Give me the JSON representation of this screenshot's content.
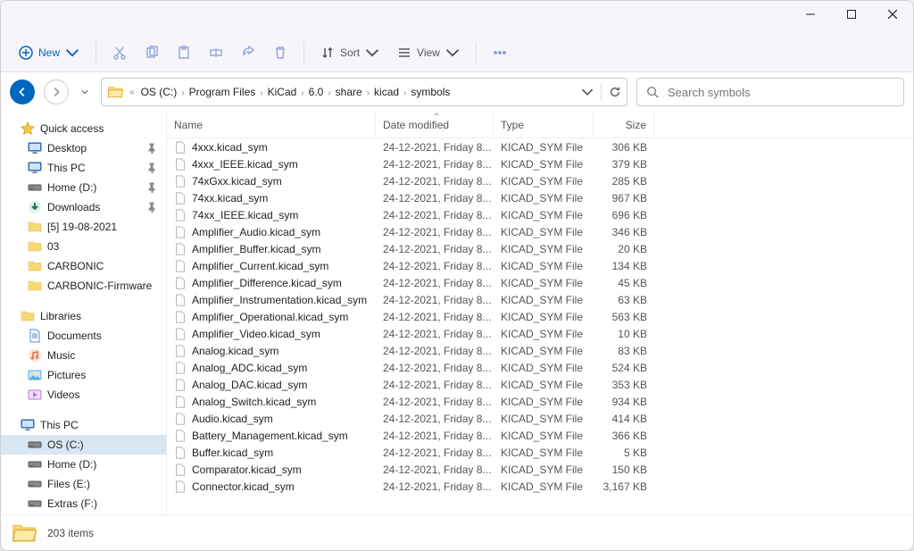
{
  "toolbar": {
    "new_label": "New",
    "sort_label": "Sort",
    "view_label": "View"
  },
  "breadcrumbs": [
    "OS (C:)",
    "Program Files",
    "KiCad",
    "6.0",
    "share",
    "kicad",
    "symbols"
  ],
  "search": {
    "placeholder": "Search symbols"
  },
  "sidebar": {
    "quick_access": "Quick access",
    "items1": [
      {
        "label": "Desktop",
        "icon": "monitor",
        "pin": true
      },
      {
        "label": "This PC",
        "icon": "monitor",
        "pin": true
      },
      {
        "label": "Home (D:)",
        "icon": "disk",
        "pin": true
      },
      {
        "label": "Downloads",
        "icon": "down",
        "pin": true
      },
      {
        "label": "[5] 19-08-2021",
        "icon": "folder",
        "pin": false
      },
      {
        "label": "03",
        "icon": "folder",
        "pin": false
      },
      {
        "label": "CARBONIC",
        "icon": "folder",
        "pin": false
      },
      {
        "label": "CARBONIC-Firmware",
        "icon": "folder",
        "pin": false
      }
    ],
    "libraries": "Libraries",
    "items2": [
      {
        "label": "Documents",
        "icon": "doc"
      },
      {
        "label": "Music",
        "icon": "mus"
      },
      {
        "label": "Pictures",
        "icon": "pic"
      },
      {
        "label": "Videos",
        "icon": "vid"
      }
    ],
    "this_pc": "This PC",
    "items3": [
      {
        "label": "OS (C:)",
        "icon": "disk",
        "selected": true
      },
      {
        "label": "Home (D:)",
        "icon": "disk"
      },
      {
        "label": "Files (E:)",
        "icon": "disk"
      },
      {
        "label": "Extras (F:)",
        "icon": "disk"
      }
    ]
  },
  "columns": {
    "name": "Name",
    "date": "Date modified",
    "type": "Type",
    "size": "Size"
  },
  "files": [
    {
      "name": "4xxx.kicad_sym",
      "date": "24-12-2021, Friday 8...",
      "type": "KICAD_SYM File",
      "size": "306 KB"
    },
    {
      "name": "4xxx_IEEE.kicad_sym",
      "date": "24-12-2021, Friday 8...",
      "type": "KICAD_SYM File",
      "size": "379 KB"
    },
    {
      "name": "74xGxx.kicad_sym",
      "date": "24-12-2021, Friday 8...",
      "type": "KICAD_SYM File",
      "size": "285 KB"
    },
    {
      "name": "74xx.kicad_sym",
      "date": "24-12-2021, Friday 8...",
      "type": "KICAD_SYM File",
      "size": "967 KB"
    },
    {
      "name": "74xx_IEEE.kicad_sym",
      "date": "24-12-2021, Friday 8...",
      "type": "KICAD_SYM File",
      "size": "696 KB"
    },
    {
      "name": "Amplifier_Audio.kicad_sym",
      "date": "24-12-2021, Friday 8...",
      "type": "KICAD_SYM File",
      "size": "346 KB"
    },
    {
      "name": "Amplifier_Buffer.kicad_sym",
      "date": "24-12-2021, Friday 8...",
      "type": "KICAD_SYM File",
      "size": "20 KB"
    },
    {
      "name": "Amplifier_Current.kicad_sym",
      "date": "24-12-2021, Friday 8...",
      "type": "KICAD_SYM File",
      "size": "134 KB"
    },
    {
      "name": "Amplifier_Difference.kicad_sym",
      "date": "24-12-2021, Friday 8...",
      "type": "KICAD_SYM File",
      "size": "45 KB"
    },
    {
      "name": "Amplifier_Instrumentation.kicad_sym",
      "date": "24-12-2021, Friday 8...",
      "type": "KICAD_SYM File",
      "size": "63 KB"
    },
    {
      "name": "Amplifier_Operational.kicad_sym",
      "date": "24-12-2021, Friday 8...",
      "type": "KICAD_SYM File",
      "size": "563 KB"
    },
    {
      "name": "Amplifier_Video.kicad_sym",
      "date": "24-12-2021, Friday 8...",
      "type": "KICAD_SYM File",
      "size": "10 KB"
    },
    {
      "name": "Analog.kicad_sym",
      "date": "24-12-2021, Friday 8...",
      "type": "KICAD_SYM File",
      "size": "83 KB"
    },
    {
      "name": "Analog_ADC.kicad_sym",
      "date": "24-12-2021, Friday 8...",
      "type": "KICAD_SYM File",
      "size": "524 KB"
    },
    {
      "name": "Analog_DAC.kicad_sym",
      "date": "24-12-2021, Friday 8...",
      "type": "KICAD_SYM File",
      "size": "353 KB"
    },
    {
      "name": "Analog_Switch.kicad_sym",
      "date": "24-12-2021, Friday 8...",
      "type": "KICAD_SYM File",
      "size": "934 KB"
    },
    {
      "name": "Audio.kicad_sym",
      "date": "24-12-2021, Friday 8...",
      "type": "KICAD_SYM File",
      "size": "414 KB"
    },
    {
      "name": "Battery_Management.kicad_sym",
      "date": "24-12-2021, Friday 8...",
      "type": "KICAD_SYM File",
      "size": "366 KB"
    },
    {
      "name": "Buffer.kicad_sym",
      "date": "24-12-2021, Friday 8...",
      "type": "KICAD_SYM File",
      "size": "5 KB"
    },
    {
      "name": "Comparator.kicad_sym",
      "date": "24-12-2021, Friday 8...",
      "type": "KICAD_SYM File",
      "size": "150 KB"
    },
    {
      "name": "Connector.kicad_sym",
      "date": "24-12-2021, Friday 8...",
      "type": "KICAD_SYM File",
      "size": "3,167 KB"
    }
  ],
  "status": {
    "count": "203 items"
  }
}
